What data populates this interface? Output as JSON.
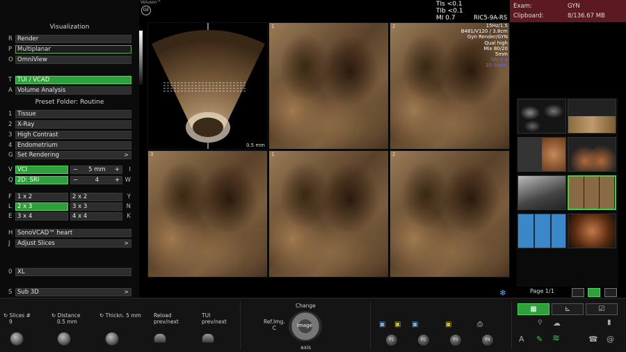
{
  "brand": {
    "product": "Voluson™",
    "mark": "GE"
  },
  "visualization": {
    "title": "Visualization",
    "items": [
      {
        "key": "R",
        "label": "Render",
        "state": "normal"
      },
      {
        "key": "P",
        "label": "Multiplanar",
        "state": "outline"
      },
      {
        "key": "O",
        "label": "OmniView",
        "state": "normal"
      }
    ],
    "tui": {
      "key": "T",
      "label": "TUI / VCAD"
    },
    "volume": {
      "key": "A",
      "label": "Volume Analysis"
    }
  },
  "preset": {
    "title": "Preset Folder: Routine",
    "items": [
      {
        "key": "1",
        "label": "Tissue"
      },
      {
        "key": "2",
        "label": "X-Ray"
      },
      {
        "key": "3",
        "label": "High Contrast"
      },
      {
        "key": "4",
        "label": "Endometrium"
      }
    ],
    "set_rendering": {
      "key": "G",
      "label": "Set Rendering",
      "arrow": ">"
    }
  },
  "vci": {
    "key": "V",
    "label": "VCI",
    "minus": "−",
    "value": "5 mm",
    "plus": "+",
    "rkey": "I"
  },
  "sri": {
    "key": "Q",
    "label": "2D: SRI",
    "minus": "−",
    "value": "4",
    "plus": "+",
    "rkey": "W"
  },
  "grid": {
    "rows": [
      {
        "lkey": "F",
        "left": "1 x 2",
        "right": "2 x 2",
        "rkey": "Y"
      },
      {
        "lkey": "L",
        "left": "2 x 3",
        "right": "3 x 3",
        "rkey": "N"
      },
      {
        "lkey": "E",
        "left": "3 x 4",
        "right": "4 x 4",
        "rkey": "K"
      }
    ]
  },
  "sono": {
    "key": "H",
    "label": "SonoVCAD™ heart"
  },
  "adjust": {
    "key": "J",
    "label": "Adjust Slices",
    "arrow": ">"
  },
  "xl": {
    "key": "0",
    "label": "XL"
  },
  "sub3d": {
    "key": "S",
    "label": "Sub 3D",
    "arrow": ">"
  },
  "header": {
    "tis": "TIs <0.1",
    "tib": "TIb <0.1",
    "mi": "MI  0.7",
    "probe": "RIC5-9A-RS"
  },
  "exam": {
    "exam_label": "Exam:",
    "exam_value": "GYN",
    "clip_label": "Clipboard:",
    "clip_value": "8/136.67 MB"
  },
  "scan_params": [
    "15Hz/1.5",
    "B481/V120 / 3.8cm",
    "Gyn Render/GYN",
    "Qual high",
    "Mix 80/20",
    "5mm",
    "SRI II 4",
    "3D Static"
  ],
  "panels": {
    "p1": "1",
    "p2": "2",
    "p3": "3",
    "p4": "1",
    "p5": "2",
    "scale": "0.5 mm"
  },
  "thumbs_page": "Page 1/1",
  "bottom": {
    "slices_label": "Slices #",
    "slices_value": "9",
    "distance_label": "Distance",
    "distance_value": "0.5 mm",
    "thick_label": "Thickn. 5 mm",
    "reload_label": "Reload",
    "reload_sub": "prev/next",
    "tui_label": "TUI",
    "tui_sub": "prev/next",
    "ref_label": "Ref.Img.",
    "ref_sub": "C",
    "change_label": "Change",
    "image_label": "Image",
    "axis_label": "axis",
    "p_buttons": [
      "P1",
      "P2",
      "P3",
      "P4"
    ]
  },
  "colors": {
    "active": "#2f9e3c",
    "exam_bg": "#5a1a20",
    "blue_text": "#5f6bff"
  },
  "icons": [
    "refresh-icon",
    "floppy-icon",
    "printer-icon",
    "grid-icon",
    "chart-icon",
    "checkbox-icon",
    "wifi-icon",
    "pen-icon",
    "phone-icon",
    "at-icon",
    "battery-icon",
    "snowflake-icon"
  ]
}
